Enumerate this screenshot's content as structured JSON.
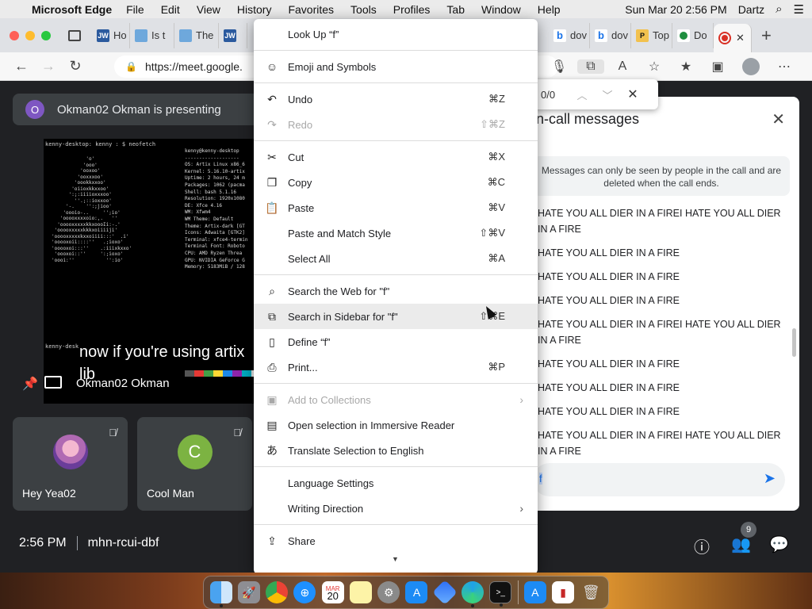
{
  "menubar": {
    "app": "Microsoft Edge",
    "items": [
      "File",
      "Edit",
      "View",
      "History",
      "Favorites",
      "Tools",
      "Profiles",
      "Tab",
      "Window",
      "Help"
    ],
    "datetime": "Sun Mar 20  2:56 PM",
    "user": "Dartz"
  },
  "tabs": {
    "left": [
      {
        "icon": "JW",
        "label": "Ho"
      },
      {
        "icon": "",
        "label": "Is t"
      },
      {
        "icon": "",
        "label": "The"
      },
      {
        "icon": "JW",
        "label": ""
      }
    ],
    "right": [
      {
        "icon": "b",
        "label": "dov"
      },
      {
        "icon": "b",
        "label": "dov"
      },
      {
        "icon": "P",
        "label": "Top"
      },
      {
        "icon": "",
        "label": "Do"
      }
    ],
    "new_tab": "+"
  },
  "toolbar": {
    "url": "https://meet.google."
  },
  "findbar": {
    "count": "0/0"
  },
  "meet": {
    "presenting_initial": "O",
    "presenting_text": "Okman02 Okman is presenting",
    "caption_line1": "now if you're using artix",
    "caption_line2": "lib",
    "presenter_name": "Okman02 Okman",
    "tiles": [
      {
        "name": "Hey Yea02",
        "initial": ""
      },
      {
        "name": "Cool Man",
        "initial": "C"
      }
    ],
    "time": "2:56 PM",
    "meeting_code": "mhn-rcui-dbf",
    "people_count": "9"
  },
  "terminal": {
    "prompt": "kenny-desktop: kenny : $ neofetch",
    "prompt2": "kenny-desk",
    "ascii": "            'o'\n           'ooo'\n          'ooxoo'\n         'ooxxxoo'\n        'oookkxxoo'\n       'oiioxkkxxoo'\n      ':;:iiiioxxxoo'\n        ''.;::ioxxoo'\n     '-.    '':;jioo'\n    'oooio-..     '';io'\n   'ooooxxxxoio:,.   ''\n  'ooooxxxxxkkxoooIi:-.'\n 'ooooxxxxxkkkxoiiiiji'\n'ooooxxxxxkxxoiiii:::'  .i'\n'ooooxoii::::''   .;ioxo'\n'ooooxoi:::''    .:iiixkxxo'\n 'oooxoi::''     ':;ioxo'\n'oooi:''           '':io'",
    "sysinfo": "kenny@kenny-desktop\n-------------------\nOS: Artix Linux x86_6\nKernel: 5.16.10-artix\nUptime: 2 hours, 24 m\nPackages: 1062 (pacma\nShell: bash 5.1.16\nResolution: 1920x1080\nDE: Xfce 4.16\nWM: Xfwm4\nWM Theme: Default\nTheme: Artix-dark [GT\nIcons: Adwaita [GTK2]\nTerminal: xfce4-termin\nTerminal Font: Roboto\nCPU: AMD Ryzen Threa\nGPU: NVIDIA GeForce G\nMemory: 5183MiB / 128"
  },
  "palette_colors": [
    "#555555",
    "#e53935",
    "#43a047",
    "#fdd835",
    "#1e88e5",
    "#8e24aa",
    "#00acc1",
    "#eeeeee"
  ],
  "chat": {
    "title": "n-call messages",
    "notice": "Messages can only be seen by people in the call and are deleted when the call ends.",
    "messages": [
      "HATE YOU ALL DIER IN A FIREI HATE YOU ALL DIER IN A FIRE",
      "HATE YOU ALL DIER IN A FIRE",
      "HATE YOU ALL DIER IN A FIRE",
      "HATE YOU ALL DIER IN A FIRE",
      "HATE YOU ALL DIER IN A FIREI HATE YOU ALL DIER IN A FIRE",
      "HATE YOU ALL DIER IN A FIRE",
      "HATE YOU ALL DIER IN A FIRE",
      "HATE YOU ALL DIER IN A FIRE",
      "HATE YOU ALL DIER IN A FIREI HATE YOU ALL DIER IN A FIRE"
    ],
    "input_value": "f"
  },
  "context_menu": {
    "look_up": "Look Up “f”",
    "emoji": "Emoji and Symbols",
    "undo": "Undo",
    "undo_sc": "⌘Z",
    "redo": "Redo",
    "redo_sc": "⇧⌘Z",
    "cut": "Cut",
    "cut_sc": "⌘X",
    "copy": "Copy",
    "copy_sc": "⌘C",
    "paste": "Paste",
    "paste_sc": "⌘V",
    "paste_match": "Paste and Match Style",
    "paste_match_sc": "⇧⌘V",
    "select_all": "Select All",
    "select_all_sc": "⌘A",
    "search_web": "Search the Web for \"f\"",
    "search_sidebar": "Search in Sidebar for \"f\"",
    "search_sidebar_sc": "⇧⌘E",
    "define": "Define “f”",
    "print": "Print...",
    "print_sc": "⌘P",
    "add_collections": "Add to Collections",
    "immersive": "Open selection in Immersive Reader",
    "translate": "Translate Selection to English",
    "language": "Language Settings",
    "writing_direction": "Writing Direction",
    "share": "Share"
  },
  "dock": {
    "calendar_month": "MAR",
    "calendar_day": "20"
  }
}
